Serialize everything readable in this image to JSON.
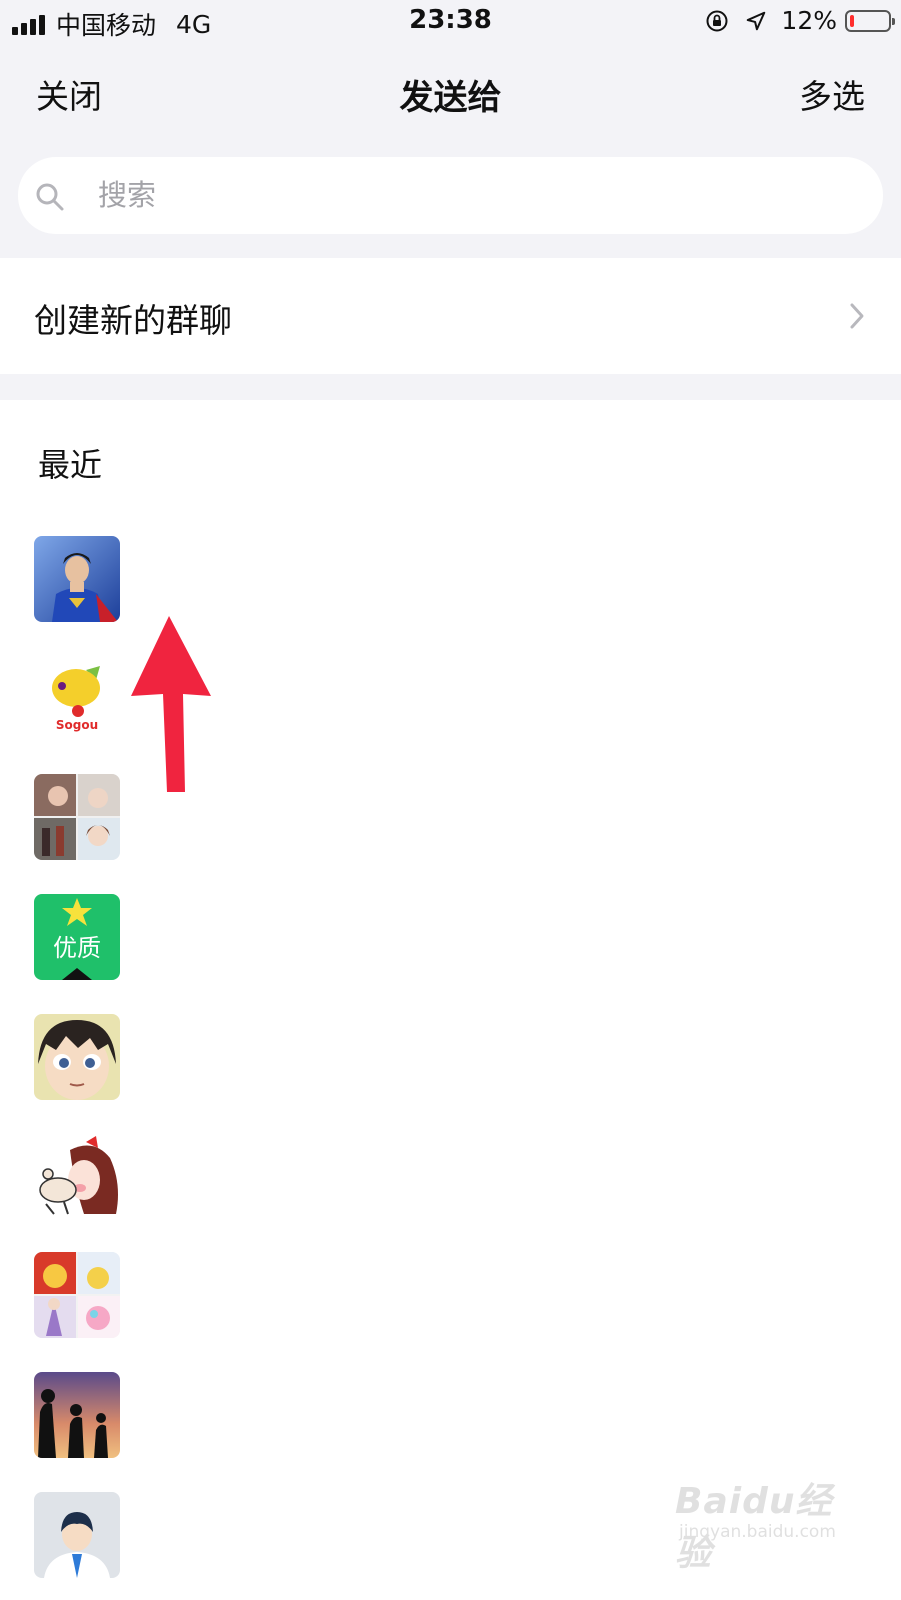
{
  "status_bar": {
    "carrier": "中国移动",
    "network": "4G",
    "time": "23:38",
    "battery": "12%",
    "battery_level": 0.12,
    "icons": [
      "signal-icon",
      "rotation-lock-icon",
      "location-icon",
      "battery-icon"
    ]
  },
  "nav": {
    "close": "关闭",
    "title": "发送给",
    "multi_select": "多选"
  },
  "search": {
    "placeholder": "搜索"
  },
  "create_group": {
    "label": "创建新的群聊"
  },
  "recent": {
    "title": "最近",
    "contacts": [
      {
        "avatar": "superhero-avatar"
      },
      {
        "avatar": "sogou-avatar",
        "text": "Sogou搜狗"
      },
      {
        "avatar": "photo-grid-avatar"
      },
      {
        "avatar": "quality-badge-avatar",
        "text": "优质"
      },
      {
        "avatar": "anime-boy-avatar"
      },
      {
        "avatar": "cartoon-girl-avatar"
      },
      {
        "avatar": "group-collage-avatar"
      },
      {
        "avatar": "sunset-silhouette-avatar"
      },
      {
        "avatar": "default-person-avatar"
      }
    ]
  },
  "watermark": {
    "logo": "Baidu经验",
    "url": "jingyan.baidu.com"
  },
  "colors": {
    "header_bg": "#f3f3f7",
    "annotation_arrow": "#f0243f",
    "quality_green": "#1fc06a",
    "battery_low": "#ff2d2d"
  }
}
